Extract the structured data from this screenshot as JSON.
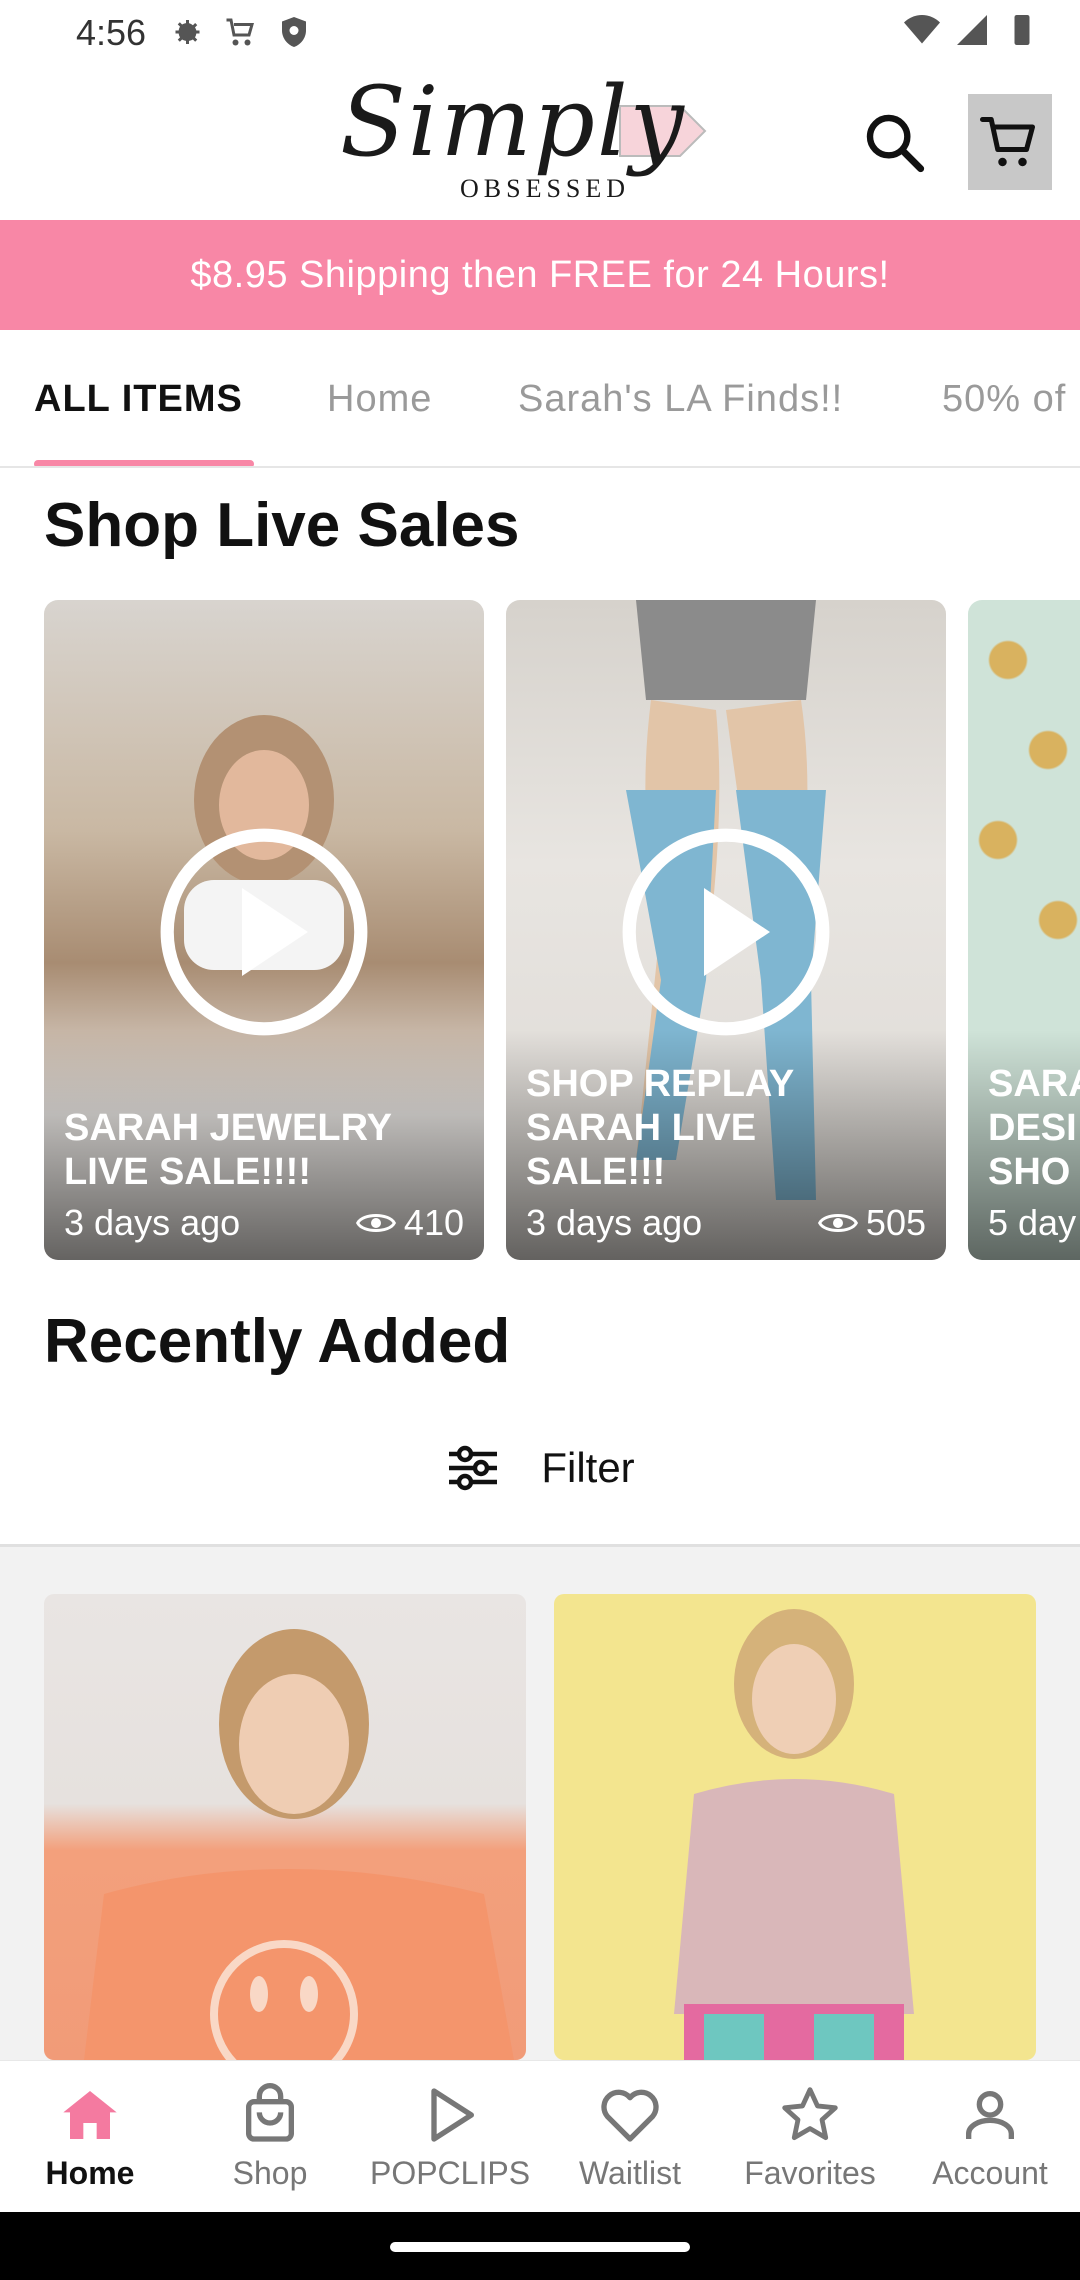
{
  "status_bar": {
    "time": "4:56",
    "icons_left": [
      "settings-icon",
      "cart-notification-icon",
      "shield-icon"
    ],
    "icons_right": [
      "wifi-icon",
      "signal-icon",
      "battery-icon"
    ]
  },
  "header": {
    "logo_script": "Simply",
    "logo_sub": "OBSESSED",
    "search_icon": "search-icon",
    "cart_icon": "cart-icon"
  },
  "promo": {
    "text": "$8.95 Shipping then FREE for 24 Hours!",
    "background": "#f887a6"
  },
  "tabs": [
    {
      "label": "ALL ITEMS",
      "active": true
    },
    {
      "label": "Home",
      "active": false
    },
    {
      "label": "Sarah's LA Finds!!",
      "active": false
    },
    {
      "label": "50% of",
      "active": false
    }
  ],
  "live_section": {
    "title": "Shop Live Sales",
    "cards": [
      {
        "title_lines": [
          "SARAH JEWELRY",
          "LIVE SALE!!!!"
        ],
        "ago": "3 days ago",
        "views": "410"
      },
      {
        "title_lines": [
          "SHOP REPLAY",
          "SARAH LIVE",
          "SALE!!!"
        ],
        "ago": "3 days ago",
        "views": "505"
      },
      {
        "title_lines": [
          "SARA",
          "DESI",
          "SHO"
        ],
        "ago": "5 day",
        "views": ""
      }
    ]
  },
  "recent_section": {
    "title": "Recently Added",
    "filter_label": "Filter"
  },
  "bottom_nav": [
    {
      "label": "Home",
      "icon": "home-icon",
      "active": true
    },
    {
      "label": "Shop",
      "icon": "shopping-bag-icon",
      "active": false
    },
    {
      "label": "POPCLIPS",
      "icon": "play-icon",
      "active": false
    },
    {
      "label": "Waitlist",
      "icon": "heart-icon",
      "active": false
    },
    {
      "label": "Favorites",
      "icon": "star-icon",
      "active": false
    },
    {
      "label": "Account",
      "icon": "account-icon",
      "active": false
    }
  ],
  "colors": {
    "accent": "#f887a6",
    "active_nav": "#f47aa0"
  }
}
